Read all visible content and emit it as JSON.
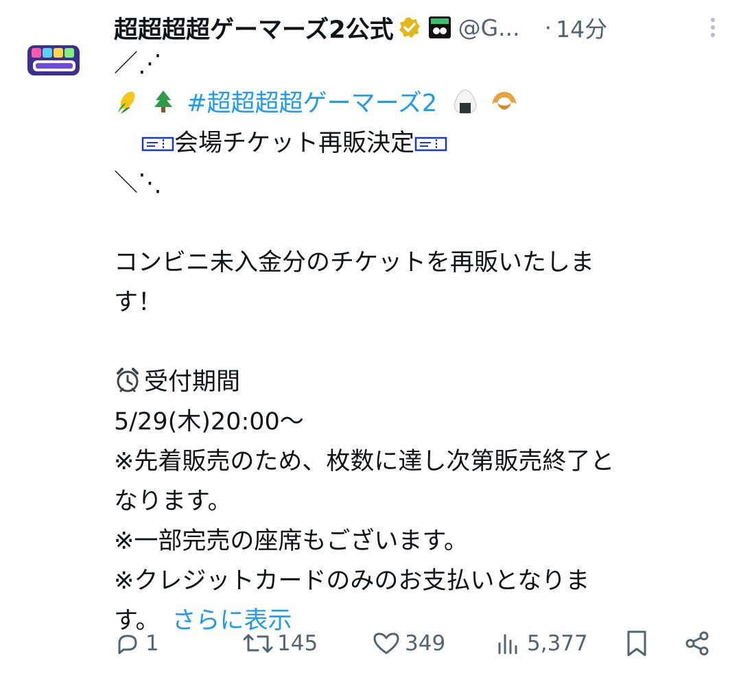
{
  "post": {
    "display_name": "超超超超ゲーマーズ2公式",
    "handle": "@G...",
    "separator": "·",
    "time": "14分",
    "hashtag": "#超超超超ゲーマーズ2",
    "line1": "／⋰",
    "ticket_line": "会場チケット再販決定",
    "line3": "＼⋱",
    "text_a1": "コンビニ未入金分のチケットを再販いたしま",
    "text_a2": "す！",
    "period_label": "受付期間",
    "period_date": "5/29(木)20:00〜",
    "note1a": "※先着販売のため、枚数に達し次第販売終了と",
    "note1b": "なります。",
    "note2": "※一部完売の座席もございます。",
    "note3a": "※クレジットカードのみのお支払いとなりま",
    "note3b": "す。",
    "show_more": "さらに表示"
  },
  "actions": {
    "replies": "1",
    "reposts": "145",
    "likes": "349",
    "views": "5,377"
  },
  "icons": [
    "avatar-logo",
    "verified-badge-icon",
    "affiliate-badge-icon",
    "more-icon",
    "corn-icon",
    "tree-icon",
    "onigiri-icon",
    "croissant-icon",
    "ticket-icon",
    "alarm-clock-icon",
    "reply-icon",
    "repost-icon",
    "like-icon",
    "views-icon",
    "bookmark-icon",
    "share-icon"
  ],
  "colors": {
    "text": "#0f1419",
    "secondary": "#536471",
    "link": "#1d9bf0",
    "verified": "#e2b719"
  }
}
